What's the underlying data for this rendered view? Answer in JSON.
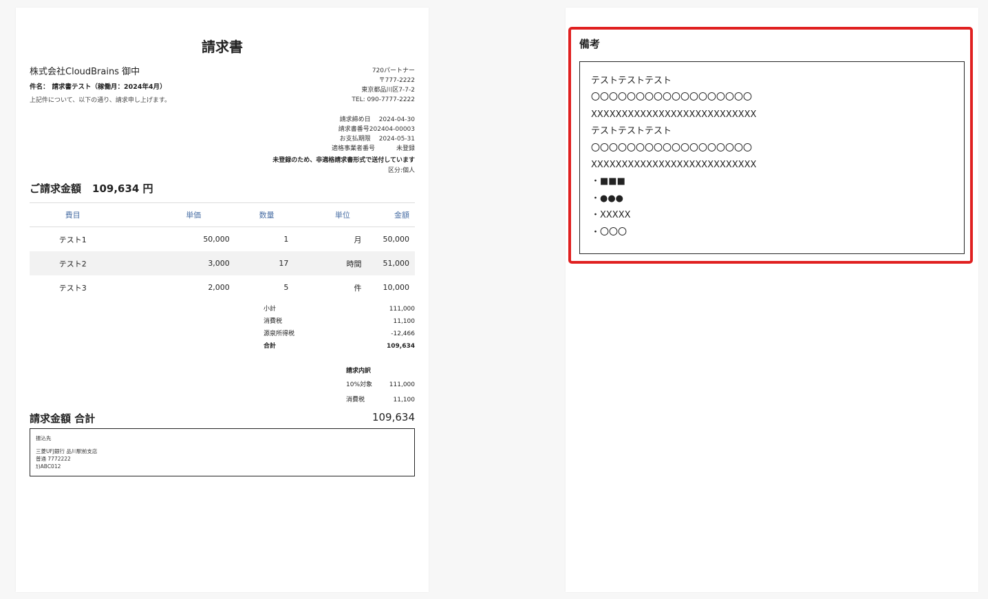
{
  "invoice": {
    "title": "請求書",
    "client": "株式会社CloudBrains 御中",
    "subject_label": "件名：",
    "subject": "請求書テスト（稼働月：2024年4月）",
    "intro": "上記件について、以下の通り、請求申し上げます。",
    "issuer": [
      "720パートナー",
      "〒777-2222",
      "東京都品川区7-7-2",
      "TEL: 090-7777-2222"
    ],
    "meta": [
      {
        "label": "請求締め日",
        "value": "2024-04-30"
      },
      {
        "label": "請求書番号",
        "value": "202404-00003"
      },
      {
        "label": "お支払期限",
        "value": "2024-05-31"
      },
      {
        "label": "適格事業者番号",
        "value": "未登録"
      }
    ],
    "notice": "未登録のため、非適格請求書形式で送付しています",
    "category": "区分:個人",
    "amount_label": "ご請求金額",
    "amount_value": "109,634 円",
    "table_headers": [
      "費目",
      "単価",
      "数量",
      "単位",
      "金額"
    ],
    "table_rows": [
      [
        "テスト1",
        "50,000",
        "1",
        "月",
        "50,000"
      ],
      [
        "テスト2",
        "3,000",
        "17",
        "時間",
        "51,000"
      ],
      [
        "テスト3",
        "2,000",
        "5",
        "件",
        "10,000"
      ]
    ],
    "totals": [
      {
        "label": "小計",
        "value": "111,000"
      },
      {
        "label": "消費税",
        "value": "11,100"
      },
      {
        "label": "源泉所得税",
        "value": "-12,466"
      },
      {
        "label": "合計",
        "value": "109,634"
      }
    ],
    "breakdown_title": "請求内訳",
    "breakdown": [
      {
        "label": "10%対象",
        "value": "111,000"
      },
      {
        "label": "消費税",
        "value": "11,100"
      }
    ],
    "grand_total_label": "請求金額 合計",
    "grand_total_value": "109,634",
    "bank_title": "振込先",
    "bank_lines": [
      "三菱UFJ銀行 品川駅前支店",
      "普通 7772222",
      "ｶ)ABC012"
    ]
  },
  "remarks": {
    "title": "備考",
    "lines": [
      "テストテストテスト",
      "〇〇〇〇〇〇〇〇〇〇〇〇〇〇〇〇〇〇",
      "XXXXXXXXXXXXXXXXXXXXXXXXXXX",
      "テストテストテスト",
      "〇〇〇〇〇〇〇〇〇〇〇〇〇〇〇〇〇〇",
      "XXXXXXXXXXXXXXXXXXXXXXXXXXX",
      "・■■■",
      "・●●●",
      "・XXXXX",
      "・〇〇〇"
    ],
    "highlight_color": "#e02020"
  }
}
